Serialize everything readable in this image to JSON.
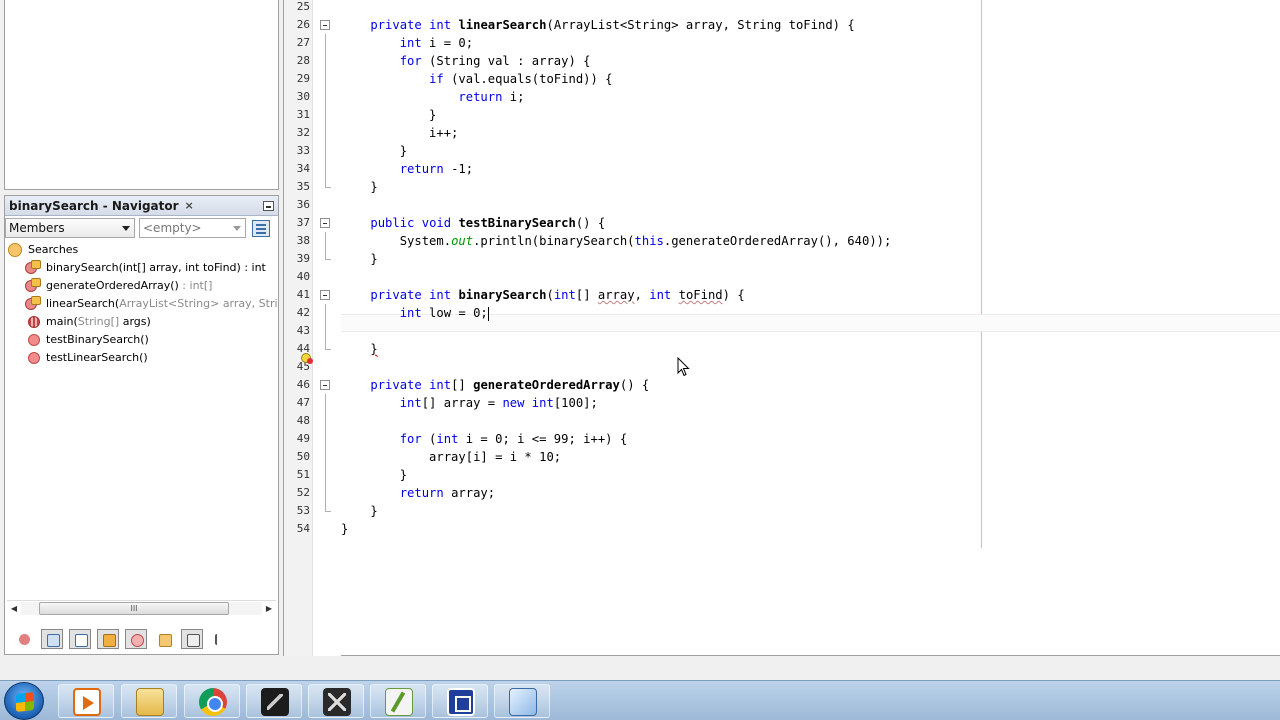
{
  "navigator": {
    "title": "binarySearch - Navigator",
    "close_glyph": "×",
    "filter_select": "Members",
    "filter_empty": "<empty>",
    "root_label": "Searches",
    "members": [
      {
        "name": "binarySearch(int[] array, int toFind) : int",
        "gray": "",
        "icon": "meth-key"
      },
      {
        "name": "generateOrderedArray()",
        "gray": " : int[]",
        "icon": "meth-key"
      },
      {
        "name": "linearSearch(",
        "gray": "ArrayList<String> array, String toF",
        "icon": "meth-key"
      },
      {
        "name": "main(",
        "gray": "String[]",
        "tail": " args)",
        "icon": "meth-static"
      },
      {
        "name": "testBinarySearch()",
        "gray": "",
        "icon": "meth"
      },
      {
        "name": "testLinearSearch()",
        "gray": "",
        "icon": "meth"
      }
    ],
    "scroll_thumb": "III"
  },
  "editor": {
    "lines": [
      {
        "n": "25",
        "html": ""
      },
      {
        "n": "26",
        "html": "    <span class='kw'>private</span> <span class='kw'>int</span> <span class='m'>linearSearch</span>(ArrayList&lt;String&gt; array, String toFind) {"
      },
      {
        "n": "27",
        "html": "        <span class='kw'>int</span> i = 0;"
      },
      {
        "n": "28",
        "html": "        <span class='kw'>for</span> (String val : array) {"
      },
      {
        "n": "29",
        "html": "            <span class='kw'>if</span> (val.equals(toFind)) {"
      },
      {
        "n": "30",
        "html": "                <span class='kw'>return</span> i;"
      },
      {
        "n": "31",
        "html": "            }"
      },
      {
        "n": "32",
        "html": "            i++;"
      },
      {
        "n": "33",
        "html": "        }"
      },
      {
        "n": "34",
        "html": "        <span class='kw'>return</span> -1;"
      },
      {
        "n": "35",
        "html": "    }"
      },
      {
        "n": "36",
        "html": ""
      },
      {
        "n": "37",
        "html": "    <span class='kw'>public</span> <span class='kw'>void</span> <span class='m'>testBinarySearch</span>() {"
      },
      {
        "n": "38",
        "html": "        System.<span class='fld'>out</span>.println(binarySearch(<span class='kw'>this</span>.generateOrderedArray(), 640));"
      },
      {
        "n": "39",
        "html": "    }"
      },
      {
        "n": "40",
        "html": ""
      },
      {
        "n": "41",
        "html": "    <span class='kw'>private</span> <span class='kw'>int</span> <span class='m'>binarySearch</span>(<span class='kw'>int</span>[] <span class='sq'>array</span>, <span class='kw'>int</span> <span class='sq'>toFind</span>) {"
      },
      {
        "n": "42",
        "html": "        <span class='kw'>int</span> low = 0;<span id='caret'></span>"
      },
      {
        "n": "43",
        "html": ""
      },
      {
        "n": "44",
        "html": "    <span class='err'>}</span>"
      },
      {
        "n": "45",
        "html": ""
      },
      {
        "n": "46",
        "html": "    <span class='kw'>private</span> <span class='kw'>int</span>[] <span class='m'>generateOrderedArray</span>() {"
      },
      {
        "n": "47",
        "html": "        <span class='kw'>int</span>[] array = <span class='kw'>new</span> <span class='kw'>int</span>[100];"
      },
      {
        "n": "48",
        "html": ""
      },
      {
        "n": "49",
        "html": "        <span class='kw'>for</span> (<span class='kw'>int</span> i = 0; i &lt;= 99; i++) {"
      },
      {
        "n": "50",
        "html": "            array[i] = i * 10;"
      },
      {
        "n": "51",
        "html": "        }"
      },
      {
        "n": "52",
        "html": "        <span class='kw'>return</span> array;"
      },
      {
        "n": "53",
        "html": "    }"
      },
      {
        "n": "54",
        "html": "}"
      }
    ]
  },
  "taskbar": {
    "apps": [
      "start-orb",
      "media-player",
      "windows-explorer",
      "chrome",
      "app-dark-1",
      "app-dark-2",
      "text-editor",
      "blue-app",
      "3d-box-app"
    ]
  }
}
